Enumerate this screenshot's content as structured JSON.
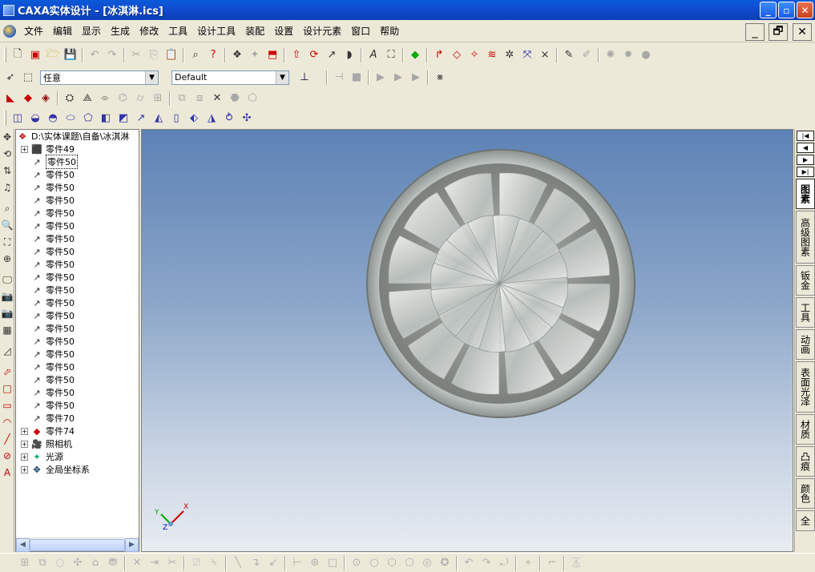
{
  "window": {
    "title": "CAXA实体设计 - [冰淇淋.ics]",
    "min_label": "_",
    "max_label": "▫",
    "close_label": "✕"
  },
  "menu": [
    "文件",
    "编辑",
    "显示",
    "生成",
    "修改",
    "工具",
    "设计工具",
    "装配",
    "设置",
    "设计元素",
    "窗口",
    "帮助"
  ],
  "mdi": {
    "min_label": "_",
    "restore_label": "🗗",
    "close_label": "✕"
  },
  "toolbar2": {
    "select_value": "任意",
    "style_value": "Default"
  },
  "tree": {
    "root": "D:\\实体课题\\自备\\冰淇淋",
    "items": [
      {
        "label": "零件49",
        "expand": "+",
        "icon": "part-solid"
      },
      {
        "label": "零件50",
        "icon": "part-curve",
        "selected": true
      },
      {
        "label": "零件50",
        "icon": "part-curve"
      },
      {
        "label": "零件50",
        "icon": "part-curve"
      },
      {
        "label": "零件50",
        "icon": "part-curve"
      },
      {
        "label": "零件50",
        "icon": "part-curve"
      },
      {
        "label": "零件50",
        "icon": "part-curve"
      },
      {
        "label": "零件50",
        "icon": "part-curve"
      },
      {
        "label": "零件50",
        "icon": "part-curve"
      },
      {
        "label": "零件50",
        "icon": "part-curve"
      },
      {
        "label": "零件50",
        "icon": "part-curve"
      },
      {
        "label": "零件50",
        "icon": "part-curve"
      },
      {
        "label": "零件50",
        "icon": "part-curve"
      },
      {
        "label": "零件50",
        "icon": "part-curve"
      },
      {
        "label": "零件50",
        "icon": "part-curve"
      },
      {
        "label": "零件50",
        "icon": "part-curve"
      },
      {
        "label": "零件50",
        "icon": "part-curve"
      },
      {
        "label": "零件50",
        "icon": "part-curve"
      },
      {
        "label": "零件50",
        "icon": "part-curve"
      },
      {
        "label": "零件50",
        "icon": "part-curve"
      },
      {
        "label": "零件50",
        "icon": "part-curve"
      },
      {
        "label": "零件70",
        "icon": "part-curve"
      },
      {
        "label": "零件74",
        "expand": "+",
        "icon": "part-solid-red"
      },
      {
        "label": "照相机",
        "expand": "+",
        "icon": "camera"
      },
      {
        "label": "光源",
        "expand": "+",
        "icon": "light"
      },
      {
        "label": "全局坐标系",
        "expand": "+",
        "icon": "axes"
      }
    ]
  },
  "viewport": {
    "axis_x": "X",
    "axis_y": "Y",
    "axis_z": "Z"
  },
  "right_tabs": [
    "图素",
    "高级图素",
    "钣金",
    "工具",
    "动画",
    "表面光泽",
    "材质",
    "凸痕",
    "颜色",
    "全"
  ],
  "colors": {
    "title_bar": "#0b3fb4",
    "viewport_top": "#5d82b6",
    "viewport_bottom": "#e8ecf2"
  }
}
